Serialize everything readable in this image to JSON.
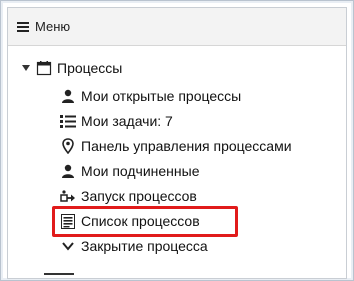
{
  "menu": {
    "title": "Меню"
  },
  "tree": {
    "root_label": "Процессы",
    "children": [
      {
        "label": "Мои открытые процессы",
        "icon": "user-icon"
      },
      {
        "label": "Мои задачи: 7",
        "icon": "task-list-icon"
      },
      {
        "label": "Панель управления процессами",
        "icon": "location-pin-icon"
      },
      {
        "label": "Мои подчиненные",
        "icon": "user-icon"
      },
      {
        "label": "Запуск процессов",
        "icon": "launch-process-icon"
      },
      {
        "label": "Список процессов",
        "icon": "process-list-icon",
        "highlighted": true
      },
      {
        "label": "Закрытие процесса",
        "icon": "chevron-down-icon"
      }
    ]
  },
  "colors": {
    "highlight": "#e11b1b"
  }
}
